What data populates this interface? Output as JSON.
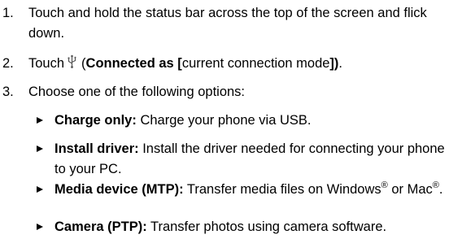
{
  "steps": [
    {
      "number": "1.",
      "text": "Touch and hold the status bar across the top of the screen and flick down."
    },
    {
      "number": "2.",
      "prefix": "Touch",
      "icon": "usb-icon",
      "open_paren": "(",
      "bold_a": "Connected as [",
      "normal_mid": "current connection mode",
      "bold_b": "])",
      "suffix": "."
    },
    {
      "number": "3.",
      "text": "Choose one of the following options:"
    }
  ],
  "options": [
    {
      "label": "Charge only:",
      "text": " Charge your phone via USB."
    },
    {
      "label": "Install driver:",
      "text": " Install the driver needed for connecting your phone to your PC."
    },
    {
      "label": "Media device (MTP):",
      "text_a": " Transfer media files on Windows",
      "sup_a": "®",
      "text_b": " or Mac",
      "sup_b": "®",
      "text_c": "."
    },
    {
      "label": "Camera (PTP):",
      "text": " Transfer photos using camera software."
    }
  ],
  "colors": {
    "text": "#000000",
    "background": "#ffffff"
  }
}
